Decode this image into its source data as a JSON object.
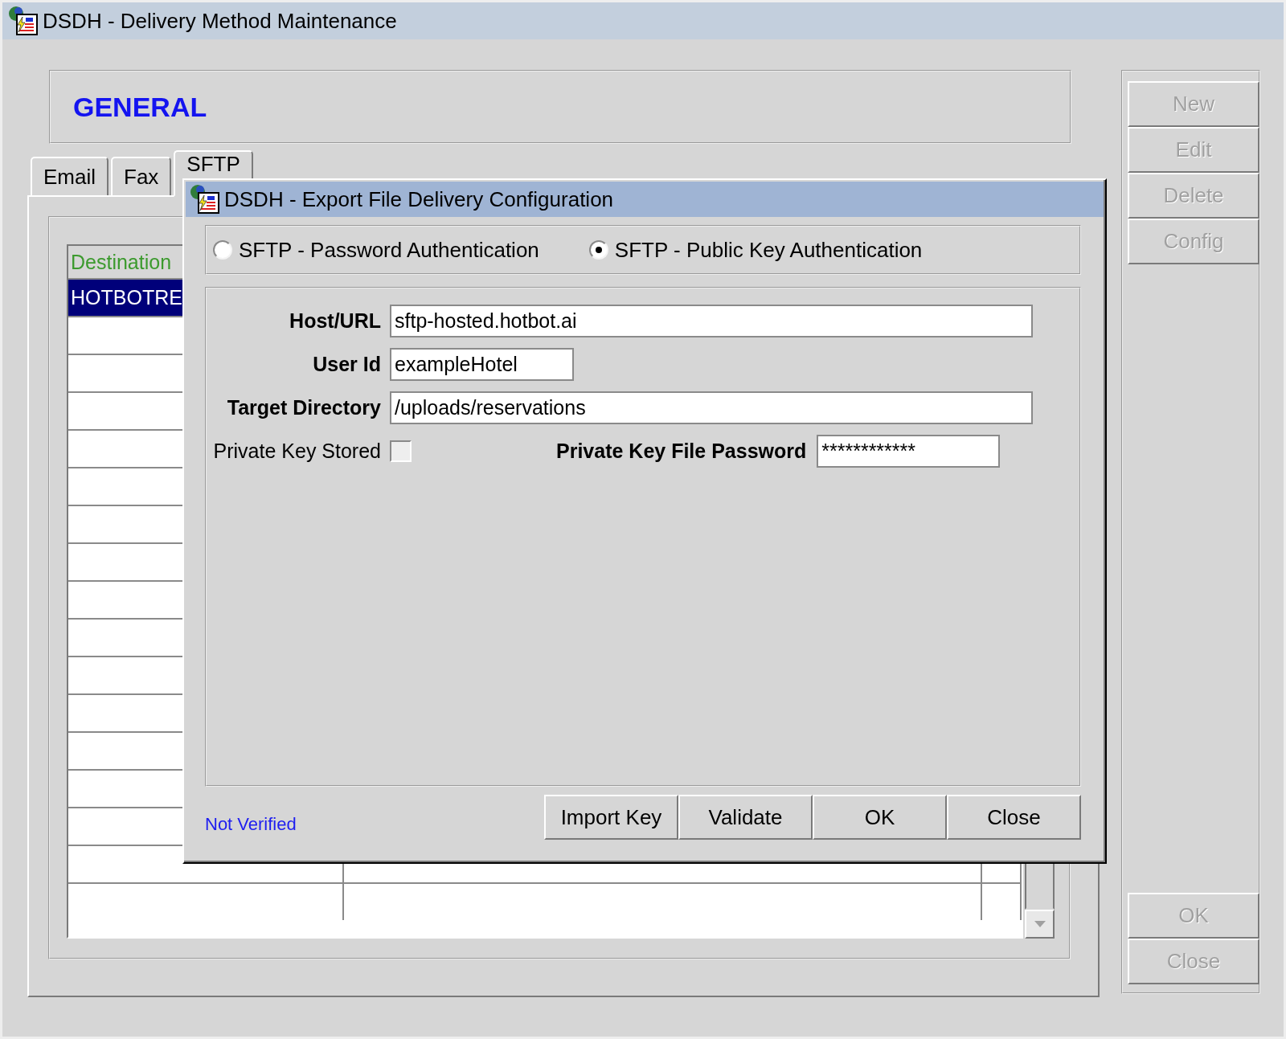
{
  "window": {
    "title": "DSDH - Delivery Method Maintenance"
  },
  "header": {
    "title": "GENERAL"
  },
  "tabs": [
    {
      "label": "Email",
      "selected": false
    },
    {
      "label": "Fax",
      "selected": false
    },
    {
      "label": "SFTP",
      "selected": true
    }
  ],
  "table": {
    "columns": [
      "Destination"
    ],
    "rows": [
      {
        "cells": [
          "HOTBOTRE"
        ],
        "selected": true
      }
    ]
  },
  "side_buttons": [
    {
      "label": "New",
      "disabled": true
    },
    {
      "label": "Edit",
      "disabled": true
    },
    {
      "label": "Delete",
      "disabled": true
    },
    {
      "label": "Config",
      "disabled": true
    }
  ],
  "footer_buttons": [
    {
      "label": "OK",
      "disabled": true
    },
    {
      "label": "Close",
      "disabled": true
    }
  ],
  "dialog": {
    "title": "DSDH - Export File Delivery Configuration",
    "auth_options": [
      {
        "label": "SFTP - Password Authentication",
        "selected": false
      },
      {
        "label": "SFTP - Public Key Authentication",
        "selected": true
      }
    ],
    "host_url": {
      "label": "Host/URL",
      "value": "sftp-hosted.hotbot.ai"
    },
    "user_id": {
      "label": "User Id",
      "value": "exampleHotel"
    },
    "target_directory": {
      "label": "Target Directory",
      "value": "/uploads/reservations"
    },
    "private_key_stored": {
      "label": "Private Key Stored",
      "checked": false
    },
    "private_key_password": {
      "label": "Private Key File Password",
      "value": "************"
    },
    "status": "Not Verified",
    "buttons": [
      {
        "label": "Import Key",
        "disabled": false
      },
      {
        "label": "Validate",
        "disabled": false
      },
      {
        "label": "OK",
        "disabled": false
      },
      {
        "label": "Close",
        "disabled": false
      }
    ]
  }
}
